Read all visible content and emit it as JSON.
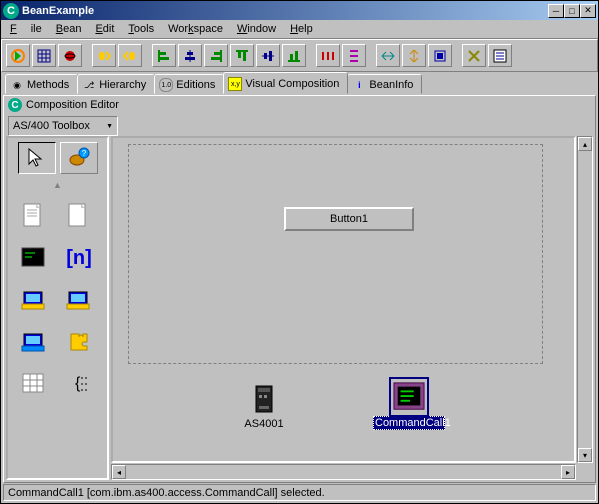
{
  "title": "BeanExample",
  "menu": {
    "file": "File",
    "bean": "Bean",
    "edit": "Edit",
    "tools": "Tools",
    "workspace": "Workspace",
    "window": "Window",
    "help": "Help"
  },
  "tabs": {
    "methods": "Methods",
    "hierarchy": "Hierarchy",
    "editions": "Editions",
    "visualComposition": "Visual Composition",
    "beanInfo": "BeanInfo"
  },
  "compositionEditor": {
    "label": "Composition Editor",
    "dropdown": "AS/400 Toolbox"
  },
  "canvas": {
    "button1Label": "Button1",
    "beans": {
      "as400": "AS4001",
      "commandCall": "CommandCall1"
    }
  },
  "status": "CommandCall1 [com.ibm.as400.access.CommandCall] selected."
}
